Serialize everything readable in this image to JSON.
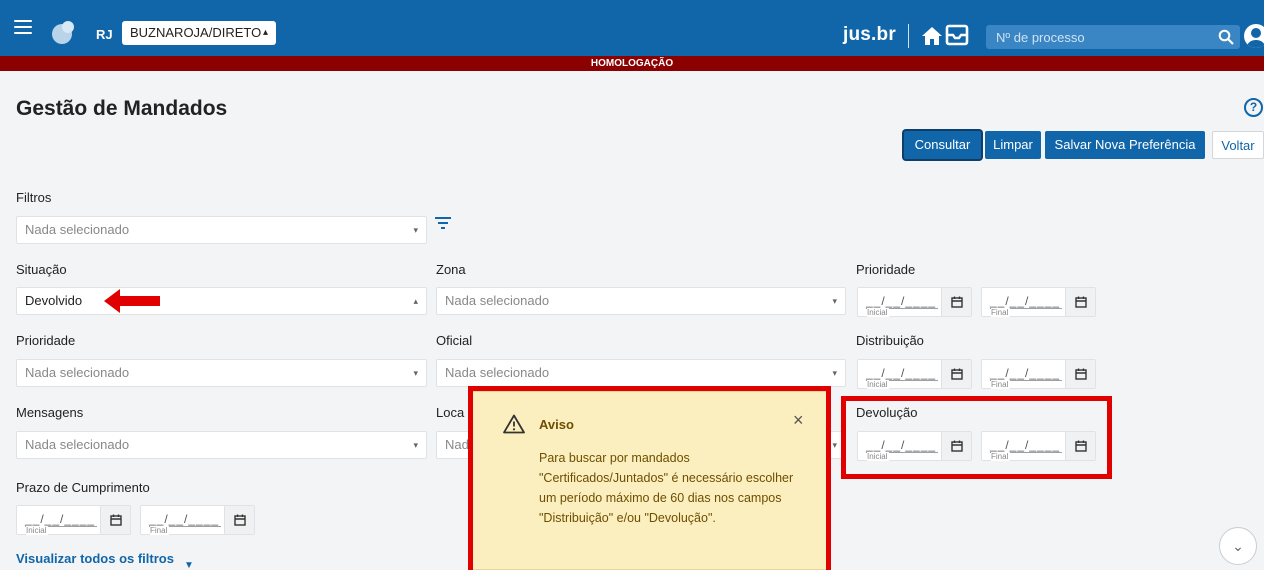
{
  "header": {
    "uf": "RJ",
    "org_select": "BUZNAROJA/DIRETO",
    "brand": "jus.br",
    "search_placeholder": "Nº de processo",
    "env_banner": "HOMOLOGAÇÃO"
  },
  "page": {
    "title": "Gestão de Mandados",
    "help": "?"
  },
  "actions": {
    "consultar": "Consultar",
    "limpar": "Limpar",
    "salvar": "Salvar Nova Preferência",
    "voltar": "Voltar"
  },
  "filters": {
    "filtros": {
      "label": "Filtros",
      "placeholder": "Nada selecionado"
    },
    "situacao": {
      "label": "Situação",
      "value": "Devolvido"
    },
    "zona": {
      "label": "Zona",
      "placeholder": "Nada selecionado"
    },
    "prioridade_select": {
      "label": "Prioridade",
      "placeholder": "Nada selecionado"
    },
    "oficial": {
      "label": "Oficial",
      "placeholder": "Nada selecionado"
    },
    "mensagens": {
      "label": "Mensagens",
      "placeholder": "Nada selecionado"
    },
    "localizacao": {
      "label": "Loca",
      "placeholder": "Nad"
    },
    "prioridade_date": {
      "label": "Prioridade"
    },
    "distribuicao": {
      "label": "Distribuição"
    },
    "devolucao": {
      "label": "Devolução"
    },
    "prazo": {
      "label": "Prazo de Cumprimento"
    }
  },
  "date_field": {
    "mask": "__/__/____",
    "inicial": "Inicial",
    "final": "Final"
  },
  "link_more": "Visualizar todos os filtros",
  "alert": {
    "title": "Aviso",
    "close": "×",
    "message": "Para buscar por mandados \"Certificados/Juntados\" é necessário escolher um período máximo de 60 dias nos campos \"Distribuição\" e/ou \"Devolução\"."
  },
  "colors": {
    "header_blue": "#1066a8",
    "env_red": "#8b0000",
    "highlight_red": "#e00000",
    "alert_bg": "#fcefbf"
  }
}
